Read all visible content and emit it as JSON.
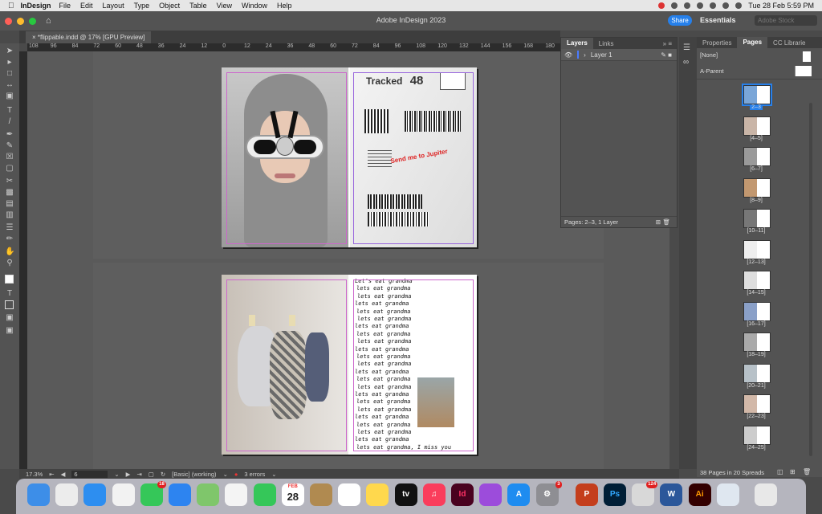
{
  "menubar": {
    "app": "InDesign",
    "items": [
      "File",
      "Edit",
      "Layout",
      "Type",
      "Object",
      "Table",
      "View",
      "Window",
      "Help"
    ],
    "datetime": "Tue 28 Feb  5:59 PM"
  },
  "titlebar": {
    "title": "Adobe InDesign 2023",
    "share": "Share",
    "workspace": "Essentials",
    "search_placeholder": "Adobe Stock"
  },
  "document": {
    "tab": "*flippable.indd @ 17% [GPU Preview]"
  },
  "ruler": {
    "labels": [
      "108",
      "96",
      "84",
      "72",
      "60",
      "48",
      "36",
      "24",
      "12",
      "0",
      "12",
      "24",
      "36",
      "48",
      "60",
      "72",
      "84",
      "96",
      "108",
      "120",
      "132",
      "144",
      "156",
      "168",
      "180"
    ]
  },
  "spread1": {
    "tracked_label": "Tracked",
    "tracked_number": "48",
    "stamp": "Send me to Jupiter"
  },
  "spread2": {
    "lines": [
      "Let's eat grandma",
      "lets eat grandma",
      "lets eat grandma",
      "lets eat grandma",
      "lets eat grandma",
      "lets eat grandma",
      "lets eat grandma",
      "lets eat grandma",
      "lets eat grandma",
      "lets eat grandma",
      "lets eat grandma",
      "lets eat grandma",
      "lets eat grandma",
      "lets eat grandma",
      "lets eat grandma",
      "lets eat grandma",
      "lets eat grandma",
      "lets eat grandma",
      "lets eat grandma",
      "lets eat grandma",
      "lets eat grandma",
      "lets eat grandma",
      "lets eat grandma, I miss you"
    ]
  },
  "layers_panel": {
    "tabs": [
      "Layers",
      "Links"
    ],
    "layer": "Layer 1",
    "footer": "Pages: 2–3, 1 Layer"
  },
  "pages_panel": {
    "tabs": [
      "Properties",
      "Pages",
      "CC Librarie"
    ],
    "none": "[None]",
    "parent": "A-Parent",
    "spreads": [
      "2–3",
      "[4–5]",
      "[6–7]",
      "[8–9]",
      "[10–11]",
      "[12–13]",
      "[14–15]",
      "[16–17]",
      "[18–19]",
      "[20–21]",
      "[22–23]",
      "[24–25]"
    ],
    "footer": "38 Pages in 20 Spreads"
  },
  "status": {
    "zoom": "17.3%",
    "page": "6",
    "preflight_profile": "[Basic] (working)",
    "errors": "3 errors"
  },
  "dock": {
    "calendar_month": "FEB",
    "calendar_day": "28",
    "badges": {
      "messages": "18",
      "settings": "3",
      "printer": "124"
    },
    "apps": [
      "Finder",
      "Launchpad",
      "Safari",
      "Chrome",
      "Messages",
      "Mail",
      "Maps",
      "Photos",
      "FaceTime",
      "Calendar",
      "Notes-brown",
      "Reminders",
      "Notes",
      "TV",
      "Music",
      "InDesign",
      "Podcasts",
      "App Store",
      "System Settings",
      "PowerPoint",
      "Photoshop",
      "Printer",
      "Word",
      "Illustrator",
      "Preview",
      "Trash"
    ],
    "labels": {
      "id": "Id",
      "ps": "Ps",
      "ai": "Ai",
      "word": "W",
      "ppt": "P",
      "tv": "tv"
    }
  }
}
